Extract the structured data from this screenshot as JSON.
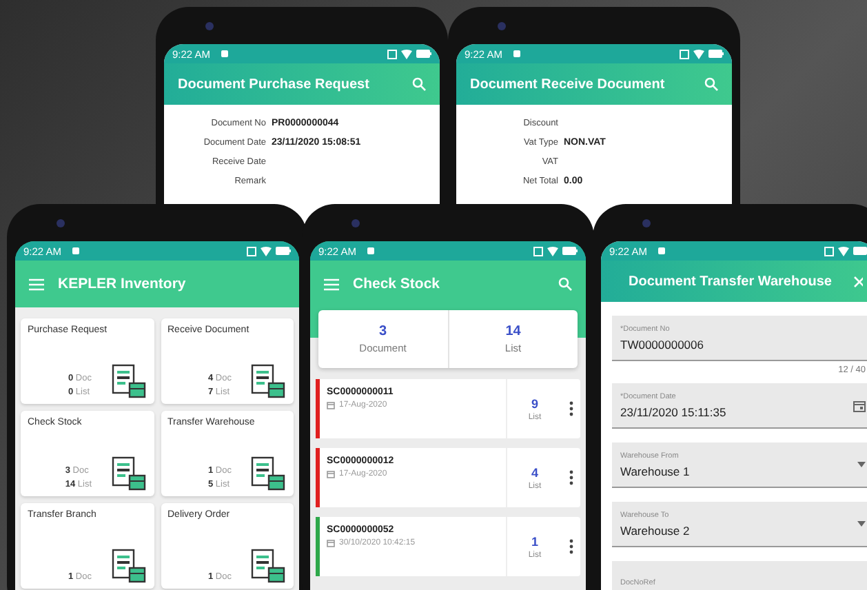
{
  "top_phones": [
    {
      "status_time": "9:22 AM",
      "title": "Document Purchase Request",
      "fields": [
        {
          "label": "Document No",
          "value": "PR0000000044"
        },
        {
          "label": "Document Date",
          "value": "23/11/2020 15:08:51"
        },
        {
          "label": "Receive Date"
        },
        {
          "label": "Remark"
        }
      ]
    },
    {
      "status_time": "9:22 AM",
      "title": "Document Receive Document",
      "fields": [
        {
          "label": "Discount"
        },
        {
          "label": "Vat Type",
          "value": "NON.VAT"
        },
        {
          "label": "VAT"
        },
        {
          "label": "Net Total",
          "value": "0.00"
        }
      ]
    }
  ],
  "home": {
    "status_time": "9:22 AM",
    "title": "KEPLER Inventory",
    "tiles": [
      {
        "title": "Purchase Request",
        "doc": "0",
        "doc_label": "Doc",
        "list": "0",
        "list_label": "List"
      },
      {
        "title": "Receive Document",
        "doc": "4",
        "doc_label": "Doc",
        "list": "7",
        "list_label": "List"
      },
      {
        "title": "Check Stock",
        "doc": "3",
        "doc_label": "Doc",
        "list": "14",
        "list_label": "List"
      },
      {
        "title": "Transfer Warehouse",
        "doc": "1",
        "doc_label": "Doc",
        "list": "5",
        "list_label": "List"
      },
      {
        "title": "Transfer Branch",
        "doc": "1",
        "doc_label": "Doc"
      },
      {
        "title": "Delivery Order",
        "doc": "1",
        "doc_label": "Doc"
      }
    ]
  },
  "check_stock": {
    "status_time": "9:22 AM",
    "title": "Check Stock",
    "summary": [
      {
        "value": "3",
        "label": "Document"
      },
      {
        "value": "14",
        "label": "List"
      }
    ],
    "items": [
      {
        "code": "SC0000000011",
        "date": "17-Aug-2020",
        "count": "9",
        "count_label": "List",
        "color": "#e02020"
      },
      {
        "code": "SC0000000012",
        "date": "17-Aug-2020",
        "count": "4",
        "count_label": "List",
        "color": "#e02020"
      },
      {
        "code": "SC0000000052",
        "date": "30/10/2020 10:42:15",
        "count": "1",
        "count_label": "List",
        "color": "#2ea84a"
      }
    ]
  },
  "transfer": {
    "status_time": "9:22 AM",
    "title": "Document Transfer Warehouse",
    "fields": [
      {
        "kind": "text",
        "label": "*Document No",
        "value": "TW0000000006",
        "counter": "12 / 40"
      },
      {
        "kind": "date",
        "label": "*Document Date",
        "value": "23/11/2020 15:11:35"
      },
      {
        "kind": "select",
        "label": "Warehouse From",
        "value": "Warehouse 1"
      },
      {
        "kind": "select",
        "label": "Warehouse To",
        "value": "Warehouse 2"
      },
      {
        "kind": "text",
        "label": "DocNoRef"
      }
    ]
  }
}
